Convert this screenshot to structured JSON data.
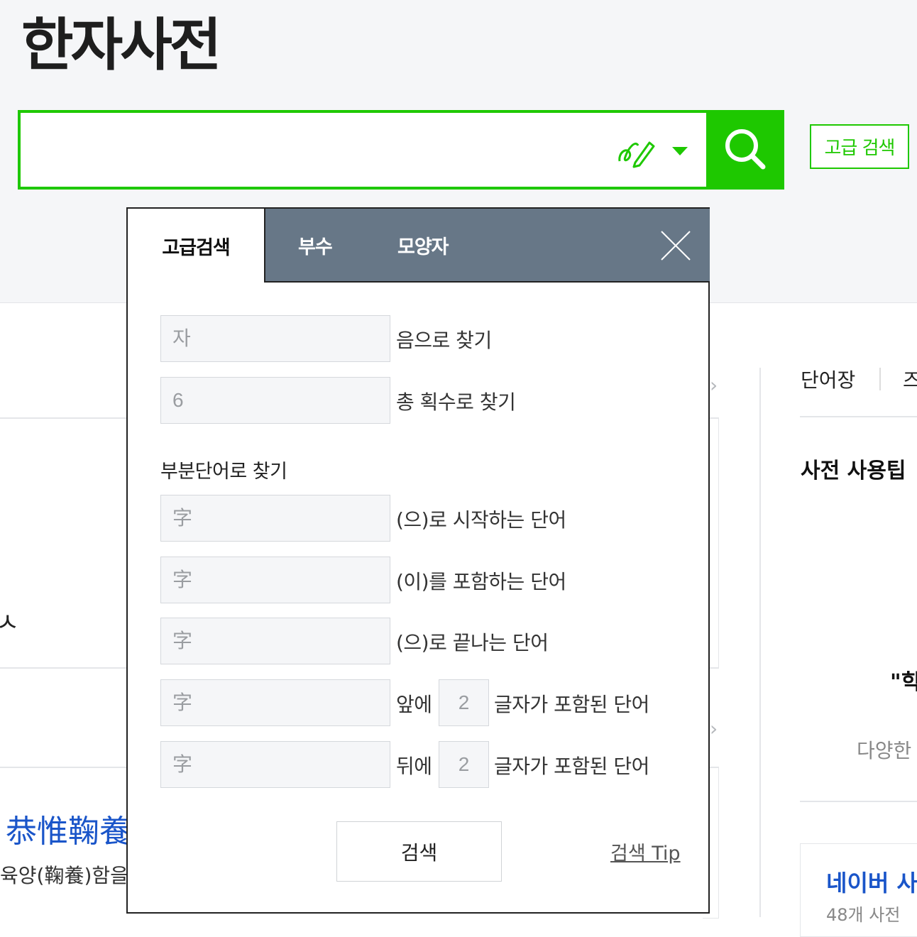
{
  "app": {
    "title": "한자사전"
  },
  "search": {
    "placeholder": "",
    "submit_label": "검색",
    "advanced_label": "고급 검색"
  },
  "background": {
    "sidebar_tabs": [
      "단어장",
      "즈"
    ],
    "tips_heading": "사전 사용팁",
    "quote_fragment": "\"힉",
    "desc_fragment": "다양한",
    "naver_title": "네이버 사",
    "naver_sub": "48개 사전",
    "idiom": "恭惟鞠養",
    "idiom_desc": "육양(鞠養)함을",
    "left_mark": "ㅅ"
  },
  "popup": {
    "tabs": [
      {
        "label": "고급검색",
        "active": true
      },
      {
        "label": "부수",
        "active": false
      },
      {
        "label": "모양자",
        "active": false
      }
    ],
    "rows": [
      {
        "placeholder": "자",
        "label": "음으로 찾기"
      },
      {
        "placeholder": "6",
        "label": "총 획수로 찾기"
      }
    ],
    "partial_title": "부분단어로 찾기",
    "partial_rows": [
      {
        "placeholder": "字",
        "label": "(으)로 시작하는 단어"
      },
      {
        "placeholder": "字",
        "label": "(이)를 포함하는 단어"
      },
      {
        "placeholder": "字",
        "label": "(으)로 끝나는 단어"
      }
    ],
    "count_rows": [
      {
        "placeholder": "字",
        "prefix": "앞에",
        "count_placeholder": "2",
        "suffix": "글자가 포함된 단어"
      },
      {
        "placeholder": "字",
        "prefix": "뒤에",
        "count_placeholder": "2",
        "suffix": "글자가 포함된 단어"
      }
    ],
    "submit_label": "검색",
    "tip_label": "검색 Tip"
  },
  "colors": {
    "accent": "#1ec800",
    "tab_bar": "#677787",
    "link": "#1a55c9"
  }
}
